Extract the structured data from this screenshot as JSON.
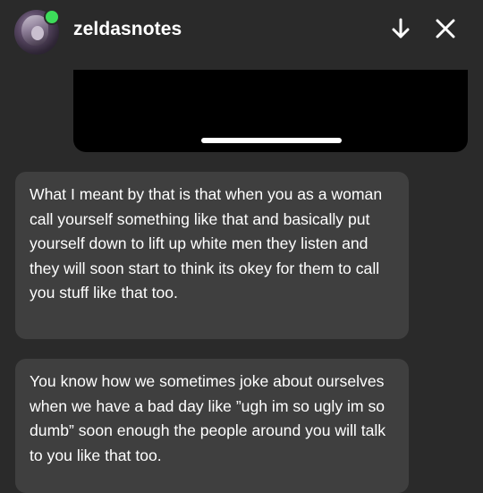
{
  "header": {
    "username": "zeldasnotes",
    "status_color": "#3ddc5a",
    "avatar_icon": "avatar",
    "download_icon": "arrow-down-icon",
    "close_icon": "close-icon"
  },
  "video": {
    "progress_color": "#ffffff"
  },
  "messages": [
    {
      "text": "What I meant by that is that when you as a woman call yourself something like that and basically put yourself down to lift up white men they listen and they will soon start to think its okey for them to call you stuff like that too."
    },
    {
      "text": "You know how we sometimes joke about ourselves when we have a bad day like ”ugh im so ugly im so dumb” soon enough the people around you will talk to you like that too."
    }
  ]
}
